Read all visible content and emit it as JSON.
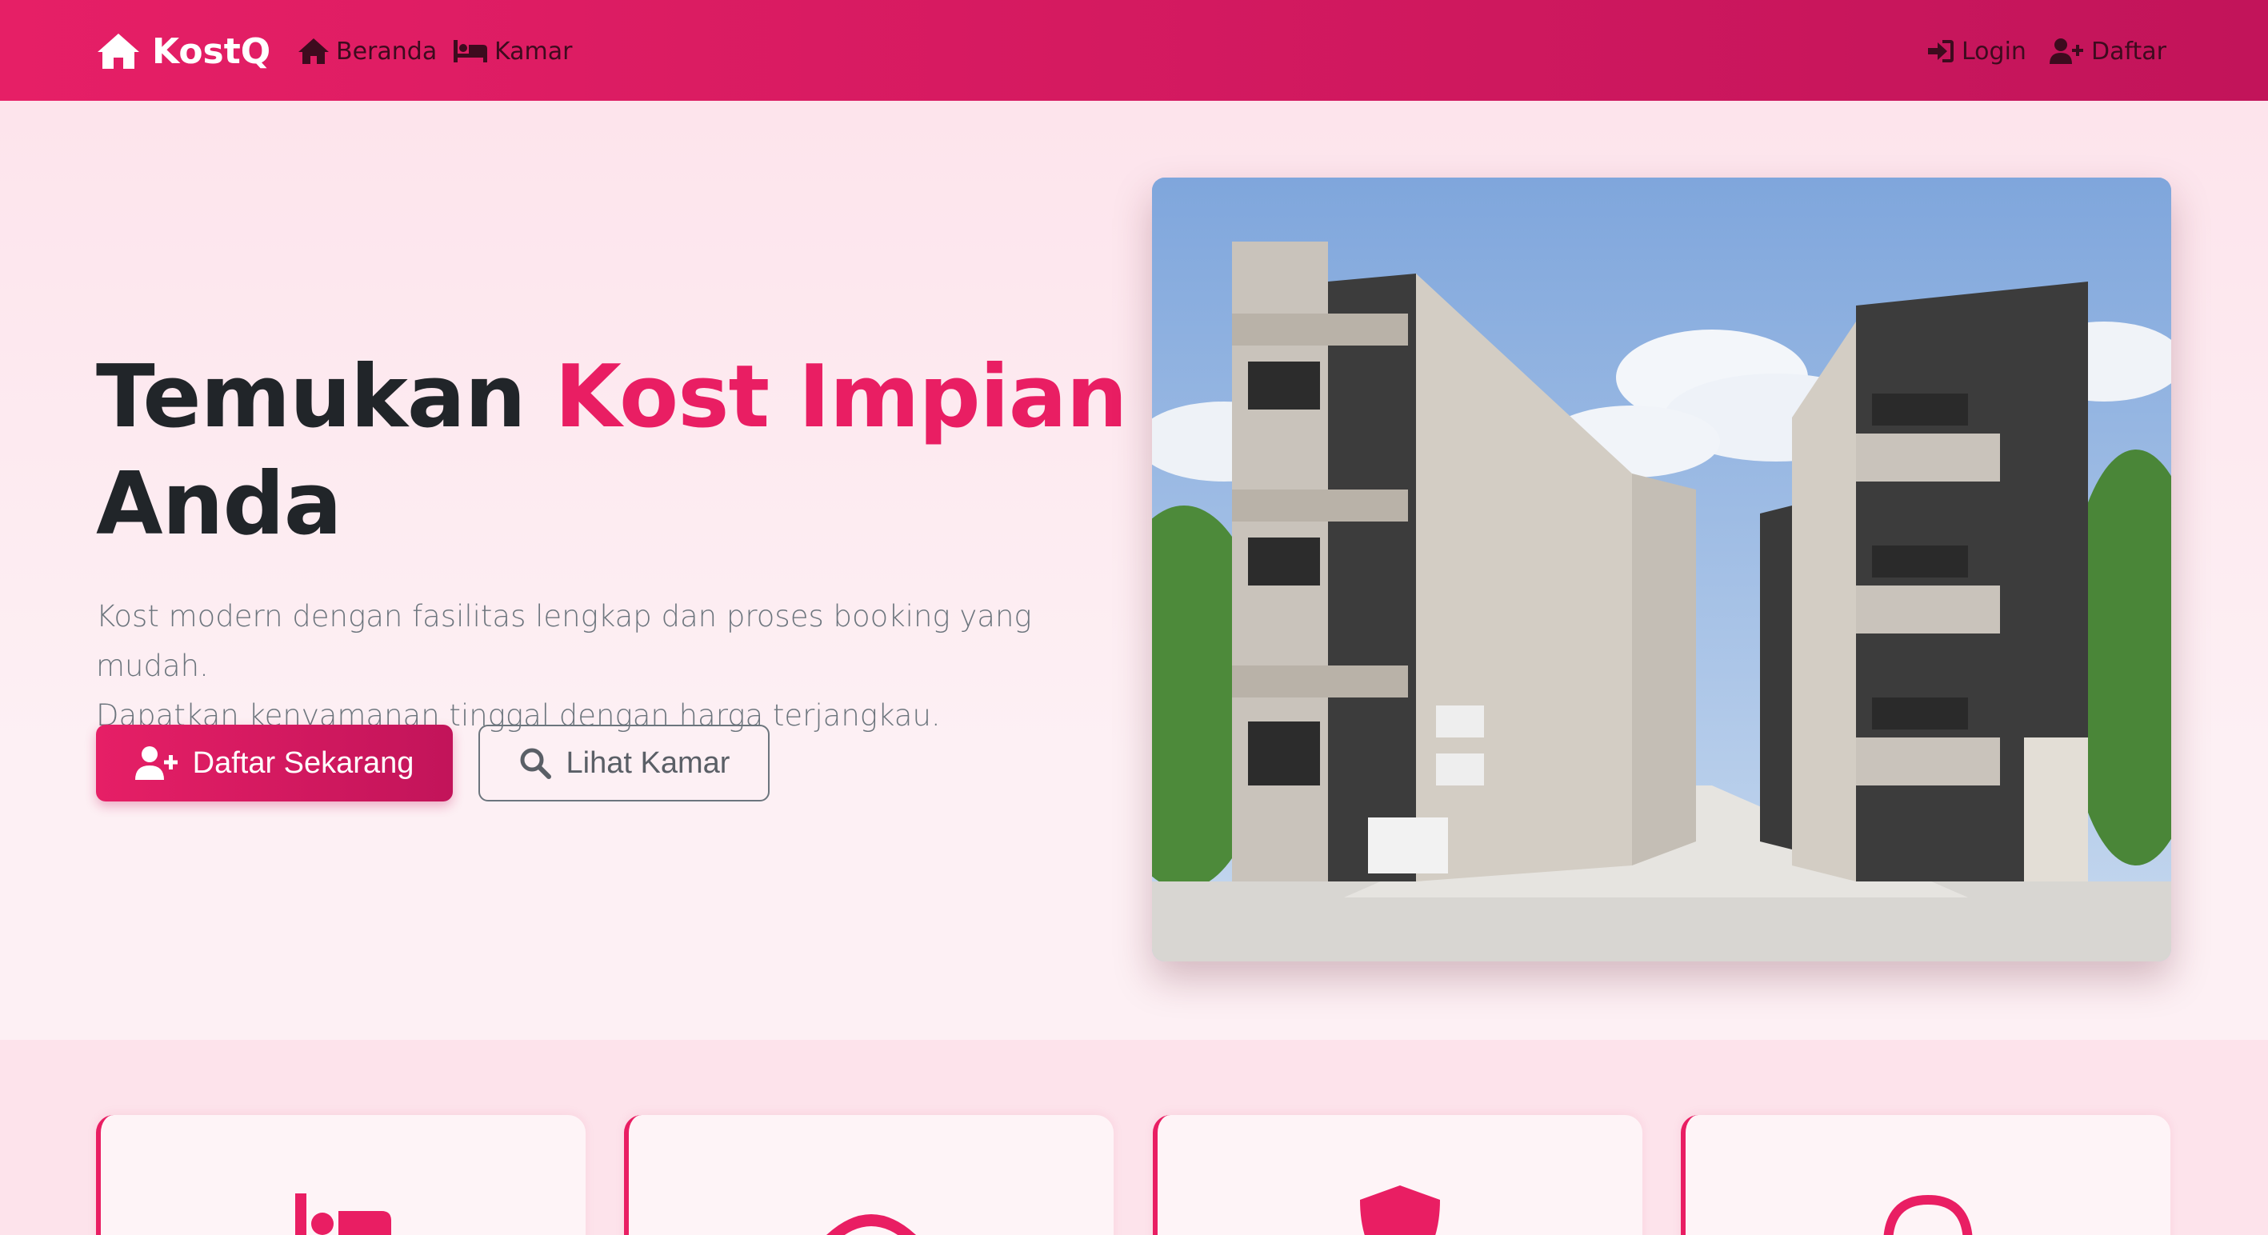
{
  "brand": {
    "name": "KostQ",
    "icon": "home-icon"
  },
  "nav": {
    "left": [
      {
        "label": "Beranda",
        "icon": "home-icon"
      },
      {
        "label": "Kamar",
        "icon": "bed-icon"
      }
    ],
    "right": [
      {
        "label": "Login",
        "icon": "sign-in-icon"
      },
      {
        "label": "Daftar",
        "icon": "user-plus-icon"
      }
    ]
  },
  "hero": {
    "title_start": "Temukan",
    "title_accent": "Kost Impian",
    "title_end": "Anda",
    "subtitle_line1": "Kost modern dengan fasilitas lengkap dan proses booking yang mudah.",
    "subtitle_line2": "Dapatkan kenyamanan tinggal dengan harga terjangkau.",
    "primary_button": "Daftar Sekarang",
    "secondary_button": "Lihat Kamar"
  },
  "features": [
    {
      "icon": "bed-icon"
    },
    {
      "icon": "wifi-icon"
    },
    {
      "icon": "shield-icon"
    },
    {
      "icon": "headset-icon"
    }
  ],
  "colors": {
    "accent": "#e91e63",
    "accent_dark": "#c2145a",
    "background": "#fde4ec",
    "nav_text": "#3d0b1e"
  }
}
